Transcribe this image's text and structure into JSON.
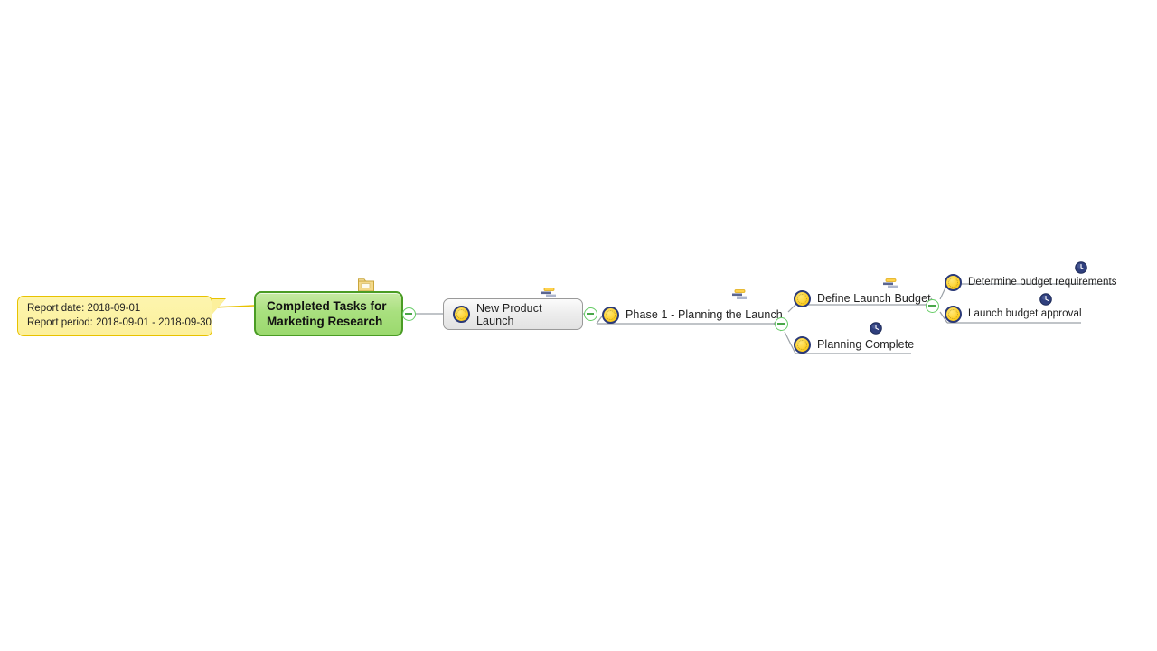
{
  "note": {
    "line1": "Report date: 2018-09-01",
    "line2": "Report period: 2018-09-01 - 2018-09-30",
    "bg_color": "#fcf09c",
    "border_color": "#e8c200"
  },
  "root": {
    "label": "Completed Tasks for\nMarketing Research",
    "icon": "folder-icon",
    "fill_color": "#a9e07f",
    "border_color": "#4a9c24"
  },
  "nodes": {
    "new_product_launch": {
      "label": "New Product Launch",
      "bullet_icon": "task-bullet-icon",
      "resource_icon": "resource-assignment-icon"
    },
    "phase_1": {
      "label": "Phase 1 - Planning the Launch",
      "bullet_icon": "task-bullet-icon",
      "resource_icon": "resource-assignment-icon"
    },
    "define_launch_budget": {
      "label": "Define Launch Budget",
      "bullet_icon": "task-bullet-icon",
      "resource_icon": "resource-assignment-icon"
    },
    "planning_complete": {
      "label": "Planning Complete",
      "bullet_icon": "task-bullet-icon",
      "clock_icon": "clock-icon"
    },
    "determine_budget_requirements": {
      "label": "Determine budget requirements",
      "bullet_icon": "task-bullet-icon",
      "clock_icon": "clock-icon"
    },
    "launch_budget_approval": {
      "label": "Launch budget approval",
      "bullet_icon": "task-bullet-icon",
      "clock_icon": "clock-icon"
    }
  },
  "controls": {
    "collapse_root": "−",
    "collapse_new_product_launch": "−",
    "collapse_phase_1": "−",
    "collapse_define_launch_budget": "−"
  },
  "colors": {
    "connector": "#9aa0a6",
    "collapse_ring": "#66cc66",
    "bullet_fill": "#ffd22e",
    "bullet_ring": "#2b3a78",
    "clock_fill": "#2f3f7d"
  }
}
